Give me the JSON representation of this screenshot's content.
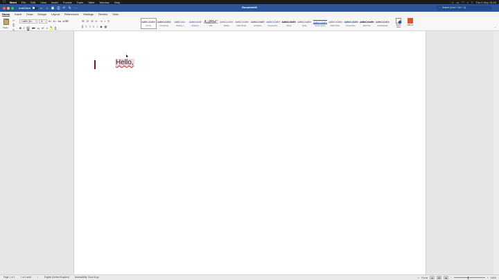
{
  "macmenu": {
    "app": "Word",
    "items": [
      "File",
      "Edit",
      "View",
      "Insert",
      "Format",
      "Tools",
      "Table",
      "Window",
      "Help"
    ],
    "clock": "Thu 5 Sep  14:43"
  },
  "titlebar": {
    "autosave_label": "AutoSave",
    "autosave_state": "off",
    "doc_title": "Document3",
    "search_placeholder": "Search (Cmd + Ctrl + U)",
    "accent": "#2b579a"
  },
  "tabs": [
    "Home",
    "Insert",
    "Draw",
    "Design",
    "Layout",
    "References",
    "Mailings",
    "Review",
    "View"
  ],
  "active_tab": "Home",
  "ribbon": {
    "paste_label": "Paste",
    "font_name": "Calibri (Bo...",
    "font_size": "12",
    "styles": [
      {
        "preview": "AaBbCcDdEe",
        "name": "Normal",
        "selected": true
      },
      {
        "preview": "AaBbCcDdEe",
        "name": "No Spacing"
      },
      {
        "preview": "AaBbCcDc",
        "name": "Heading 1"
      },
      {
        "preview": "AaBbCcDdE",
        "name": "Heading 2"
      },
      {
        "preview": "AaBbC",
        "name": "Title",
        "big": true
      },
      {
        "preview": "AaBbCcDdEe",
        "name": "Subtitle"
      },
      {
        "preview": "AaBbCcDdEe",
        "name": "Subtle Emph..."
      },
      {
        "preview": "AaBbCcDdEe",
        "name": "Emphasis"
      },
      {
        "preview": "AaBbCcDdEe",
        "name": "Intense Emp..."
      },
      {
        "preview": "AaBbCcDdEe",
        "name": "Strong"
      },
      {
        "preview": "AaBbCcDdEe",
        "name": "Quote"
      },
      {
        "preview": "AaBbCcDdEe",
        "name": "Intense Quote"
      },
      {
        "preview": "AaBbCcDdEe",
        "name": "Subtle Refer..."
      },
      {
        "preview": "AaBbCcDdEe",
        "name": "Intense Refe..."
      },
      {
        "preview": "AaBbCcDdEe",
        "name": "Book Title"
      },
      {
        "preview": "AaBbCcDdEe",
        "name": "List Paragraph"
      }
    ],
    "styles_pane_label": "Styles Pane",
    "addins_label": "Add-ins"
  },
  "document": {
    "text": "Hello,"
  },
  "status": {
    "page": "Page 1 of 1",
    "words": "1 of 1 word",
    "language": "English (United Kingdom)",
    "accessibility": "Accessibility: Good to go",
    "focus": "Focus",
    "zoom": "164%"
  }
}
